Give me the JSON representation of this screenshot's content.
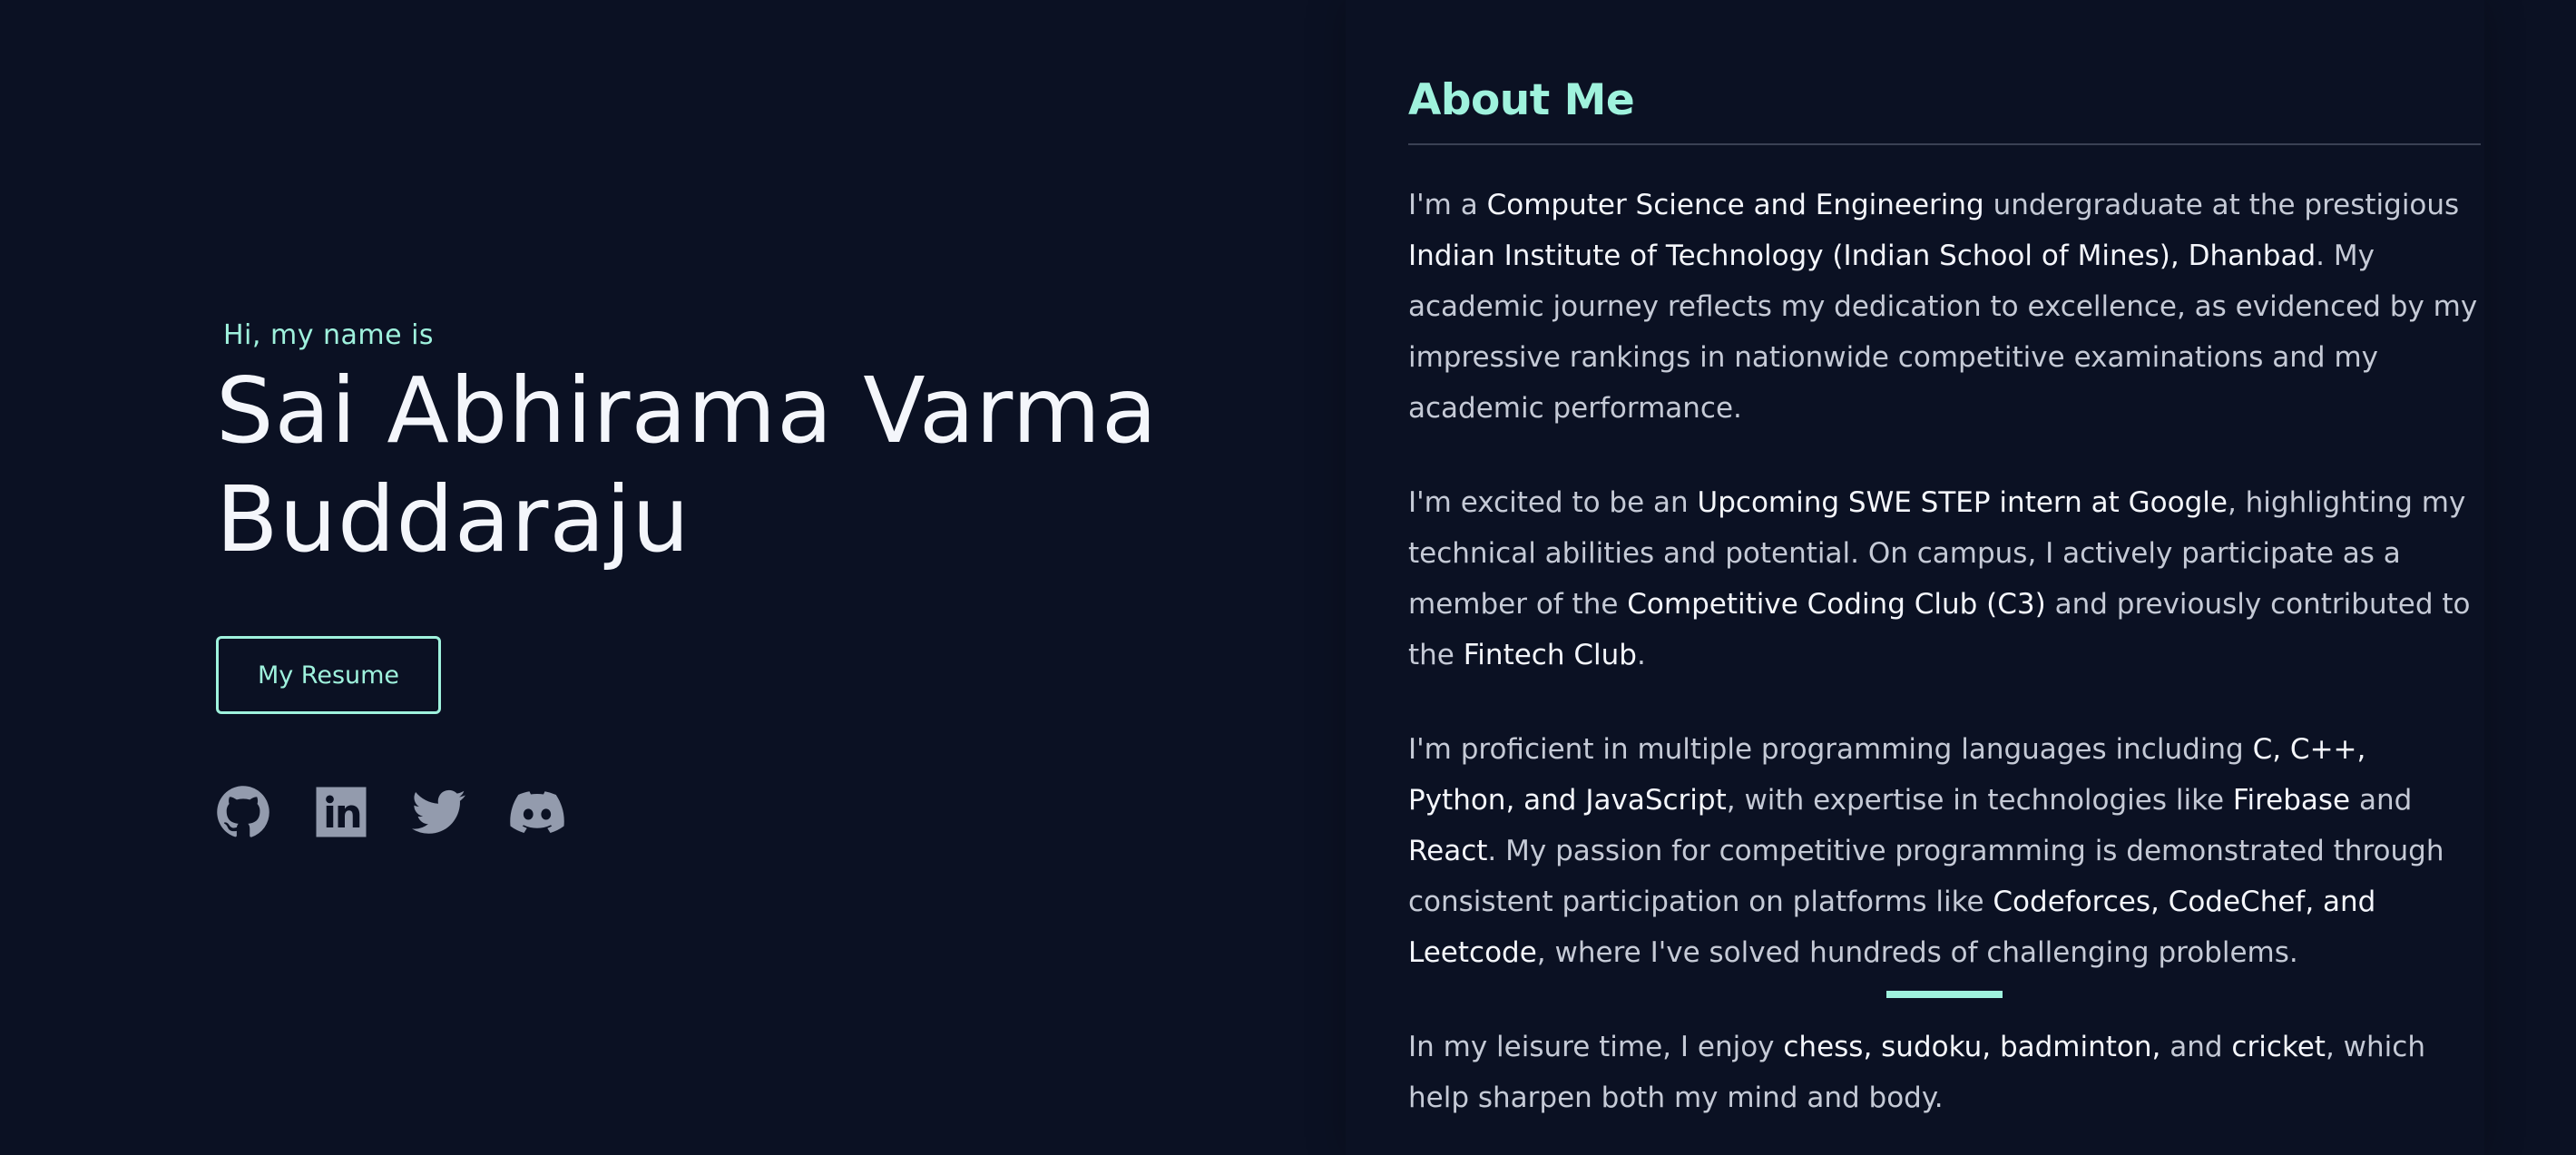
{
  "hero": {
    "greeting": "Hi, my name is",
    "name_line1": "Sai Abhirama Varma",
    "name_line2": "Buddaraju",
    "resume_label": "My Resume",
    "socials": [
      {
        "icon": "github-icon"
      },
      {
        "icon": "linkedin-icon"
      },
      {
        "icon": "twitter-icon"
      },
      {
        "icon": "discord-icon"
      }
    ]
  },
  "about": {
    "title": "About Me",
    "p1": [
      {
        "t": "I'm a ",
        "hl": false
      },
      {
        "t": "Computer Science and Engineering",
        "hl": true
      },
      {
        "t": " undergraduate at the prestigious ",
        "hl": false
      },
      {
        "t": "Indian Institute of Technology (Indian School of Mines), Dhanbad",
        "hl": true
      },
      {
        "t": ". My academic journey reflects my dedication to excellence, as evidenced by my impressive rankings in nationwide competitive examinations and my academic performance.",
        "hl": false
      }
    ],
    "p2": [
      {
        "t": "I'm excited to be an ",
        "hl": false
      },
      {
        "t": "Upcoming SWE STEP intern at Google",
        "hl": true
      },
      {
        "t": ", highlighting my technical abilities and potential. On campus, I actively participate as a member of the ",
        "hl": false
      },
      {
        "t": "Competitive Coding Club (C3)",
        "hl": true
      },
      {
        "t": " and previously contributed to the ",
        "hl": false
      },
      {
        "t": "Fintech Club",
        "hl": true
      },
      {
        "t": ".",
        "hl": false
      }
    ],
    "p3": [
      {
        "t": "I'm proficient in multiple programming languages including ",
        "hl": false
      },
      {
        "t": "C, C++, Python, and JavaScript",
        "hl": true
      },
      {
        "t": ", with expertise in technologies like ",
        "hl": false
      },
      {
        "t": "Firebase",
        "hl": true
      },
      {
        "t": " and ",
        "hl": false
      },
      {
        "t": "React",
        "hl": true
      },
      {
        "t": ". My passion for competitive programming is demonstrated through consistent participation on platforms like ",
        "hl": false
      },
      {
        "t": "Codeforces, CodeChef, and Leetcode",
        "hl": true
      },
      {
        "t": ", where I've solved hundreds of challenging problems.",
        "hl": false
      }
    ],
    "p4": [
      {
        "t": "In my leisure time, I enjoy ",
        "hl": false
      },
      {
        "t": "chess, sudoku, badminton,",
        "hl": true
      },
      {
        "t": " and ",
        "hl": false
      },
      {
        "t": "cricket",
        "hl": true
      },
      {
        "t": ", which help sharpen both my mind and body.",
        "hl": false
      }
    ]
  },
  "colors": {
    "background": "#0b1123",
    "accent": "#9ff2dd",
    "text": "#c5cad6",
    "highlight": "#f4f6fb",
    "icon": "#939bad"
  }
}
